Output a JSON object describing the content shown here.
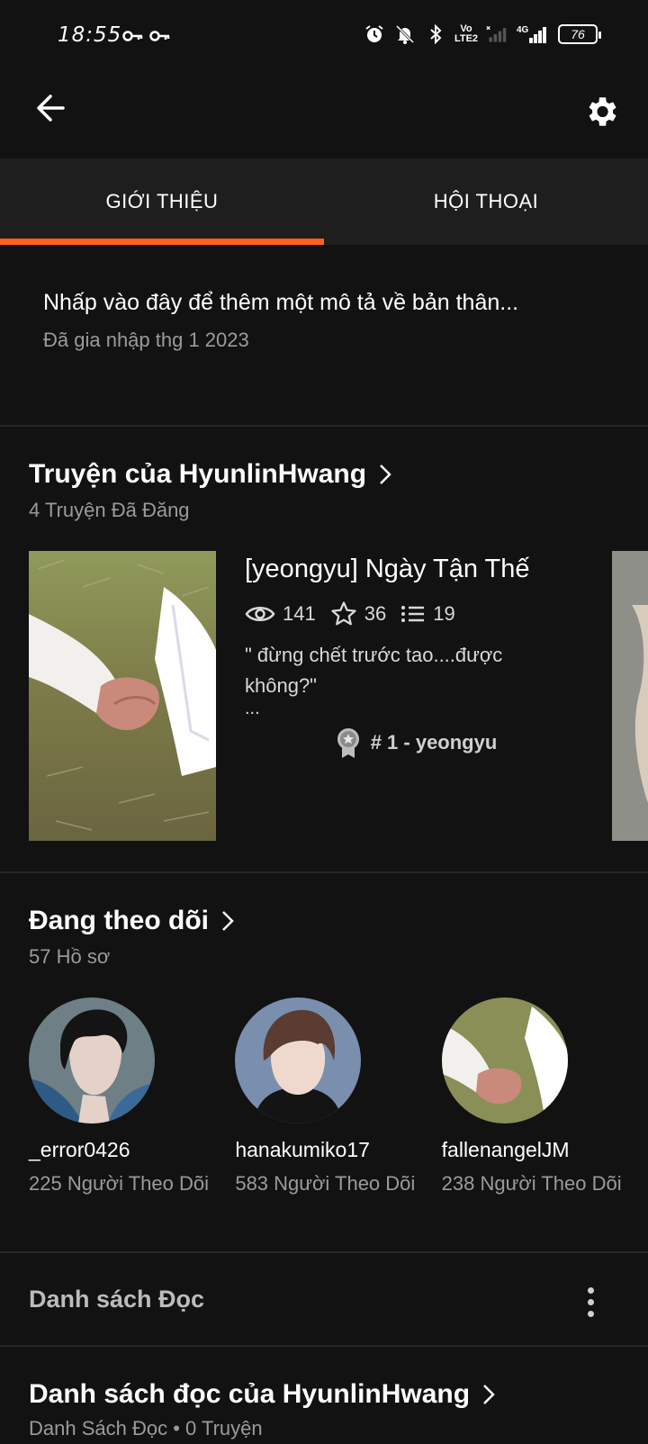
{
  "status_bar": {
    "time": "18:55",
    "battery": "76",
    "volte_line1": "Vo",
    "volte_line2": "LTE2",
    "network": "4G"
  },
  "tabs": [
    {
      "label": "GIỚI THIỆU",
      "active": true
    },
    {
      "label": "HỘI THOẠI",
      "active": false
    }
  ],
  "about": {
    "description": "Nhấp vào đây để thêm một mô tả về bản thân...",
    "joined": "Đã gia nhập thg 1 2023"
  },
  "stories_section": {
    "title": "Truyện của HyunlinHwang",
    "subtitle": "4 Truyện Đã Đăng"
  },
  "story": {
    "title": "[yeongyu] Ngày Tận Thế",
    "views": "141",
    "votes": "36",
    "parts": "19",
    "description": "\" đừng chết trước tao....được không?\"",
    "ellipsis": "...",
    "rank": "# 1 - yeongyu"
  },
  "following_section": {
    "title": "Đang theo dõi",
    "subtitle": "57 Hồ sơ"
  },
  "profiles": [
    {
      "name": "_error0426",
      "followers": "225 Người Theo Dõi"
    },
    {
      "name": "hanakumiko17",
      "followers": "583 Người Theo Dõi"
    },
    {
      "name": "fallenangelJM",
      "followers": "238 Người Theo Dõi"
    }
  ],
  "reading_list": {
    "header": "Danh sách Đọc",
    "title": "Danh sách đọc của HyunlinHwang",
    "subtitle": "Danh Sách Đọc • 0 Truyện"
  },
  "colors": {
    "background": "#121212",
    "accent": "#ff6122",
    "tab_bar": "#1e1e1e",
    "muted_text": "#9b9b9b"
  }
}
